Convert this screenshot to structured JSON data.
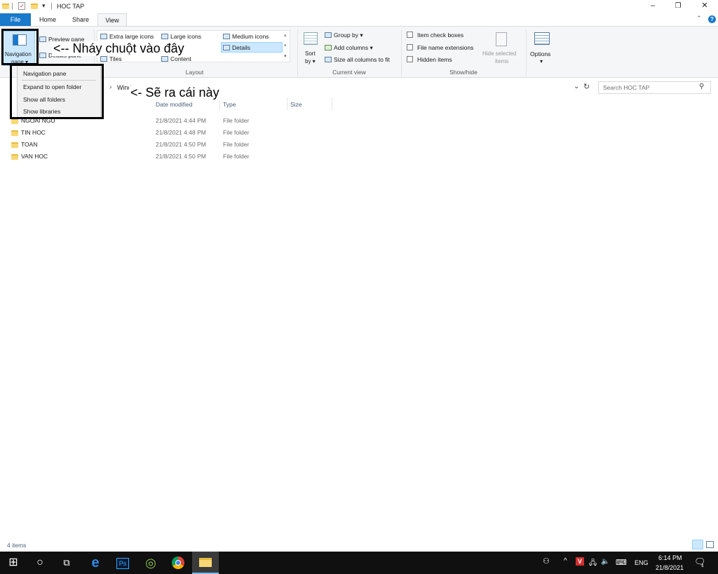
{
  "window": {
    "title": "HOC TAP",
    "minimize_glyph": "–",
    "restore_glyph": "❐",
    "close_glyph": "✕"
  },
  "tabs": {
    "file": "File",
    "home": "Home",
    "share": "Share",
    "view": "View"
  },
  "ribbon": {
    "panes": {
      "navigation_pane_line1": "Navigation",
      "navigation_pane_line2": "pane ▾",
      "preview_pane": "Preview pane",
      "details_pane": "Details pane"
    },
    "layout": {
      "extra_large_icons": "Extra large icons",
      "large_icons": "Large icons",
      "medium_icons": "Medium icons",
      "details": "Details",
      "tiles": "Tiles",
      "content": "Content",
      "label": "Layout"
    },
    "current_view": {
      "sort_line1": "Sort",
      "sort_line2": "by ▾",
      "group_by": "Group by ▾",
      "add_columns": "Add columns ▾",
      "size_all_columns": "Size all columns to fit",
      "label": "Current view"
    },
    "show_hide": {
      "item_check_boxes": "Item check boxes",
      "file_name_extensions": "File name extensions",
      "hidden_items": "Hidden items",
      "hide_selected_line1": "Hide selected",
      "hide_selected_line2": "items",
      "label": "Show/hide"
    },
    "options_label": "Options",
    "options_arrow": "▾"
  },
  "address": {
    "crumb_sep": "›",
    "crumb_text": "Wind",
    "search_placeholder": "Search HOC TAP"
  },
  "columns": {
    "date_modified": "Date modified",
    "type": "Type",
    "size": "Size"
  },
  "files": [
    {
      "name": "NGOAI NGU",
      "date": "21/8/2021 4:44 PM",
      "type": "File folder"
    },
    {
      "name": "TIN HOC",
      "date": "21/8/2021 4:48 PM",
      "type": "File folder"
    },
    {
      "name": "TOAN",
      "date": "21/8/2021 4:50 PM",
      "type": "File folder"
    },
    {
      "name": "VAN HOC",
      "date": "21/8/2021 4:50 PM",
      "type": "File folder"
    }
  ],
  "nav_menu": {
    "navigation_pane": "Navigation pane",
    "expand_to_open_folder": "Expand to open folder",
    "show_all_folders": "Show all folders",
    "show_libraries": "Show libraries"
  },
  "annotations": {
    "click_here": "<-- Nháy chuột vào đây",
    "this_appears": "<- Sẽ ra cái này"
  },
  "status": {
    "item_count": "4 items"
  },
  "taskbar": {
    "language": "ENG",
    "time": "6:14 PM",
    "date": "21/8/2021",
    "notification_count": "1"
  },
  "colors": {
    "file_tab": "#1979ca",
    "folder": "#f8d775",
    "taskbar": "#101010",
    "ribbon_bg": "#f5f6f7",
    "selected": "#cce8ff"
  }
}
